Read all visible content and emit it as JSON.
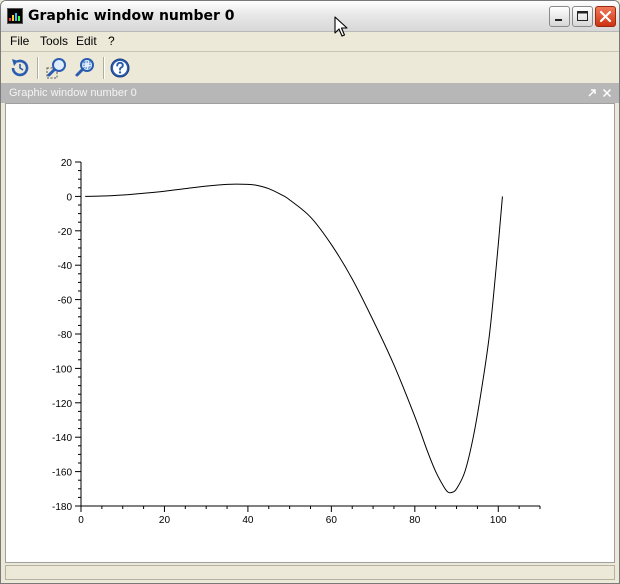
{
  "window": {
    "title": "Graphic window number 0",
    "icon": "scilab-graphic-icon"
  },
  "menu": {
    "items": [
      {
        "id": "file",
        "label": "File"
      },
      {
        "id": "tools",
        "label": "Tools"
      },
      {
        "id": "edit",
        "label": "Edit"
      },
      {
        "id": "help",
        "label": "?"
      }
    ]
  },
  "toolbar": {
    "buttons": [
      {
        "id": "rotate",
        "icon": "rotate-3d-icon"
      },
      {
        "id": "zoom",
        "icon": "zoom-icon"
      },
      {
        "id": "unzoom",
        "icon": "zoom-fit-icon"
      },
      {
        "id": "help",
        "icon": "help-icon"
      }
    ]
  },
  "panel": {
    "title": "Graphic window number 0"
  },
  "colors": {
    "panel_header": "#b7b7b7",
    "curve": "#000000",
    "close_button": "#cc3311"
  },
  "chart_data": {
    "type": "line",
    "title": "",
    "xlabel": "",
    "ylabel": "",
    "xlim": [
      0,
      110
    ],
    "ylim": [
      -180,
      20
    ],
    "xticks": [
      0,
      20,
      40,
      60,
      80,
      100
    ],
    "yticks": [
      20,
      0,
      -20,
      -40,
      -60,
      -80,
      -100,
      -120,
      -140,
      -160,
      -180
    ],
    "x_minor_step": 5,
    "y_minor_step": 5,
    "grid": false,
    "series": [
      {
        "x": [
          1,
          5,
          10,
          15,
          20,
          25,
          30,
          35,
          40,
          42,
          45,
          48,
          50,
          55,
          60,
          65,
          70,
          75,
          80,
          83,
          85,
          87,
          88,
          89,
          90,
          92,
          94,
          96,
          98,
          100,
          101
        ],
        "y": [
          0,
          0.2,
          0.8,
          1.8,
          3,
          4.5,
          6,
          7,
          7,
          6.5,
          4.5,
          1,
          -2,
          -12,
          -28,
          -48,
          -72,
          -98,
          -128,
          -148,
          -160,
          -169,
          -172,
          -172,
          -170,
          -160,
          -140,
          -112,
          -78,
          -28,
          0
        ]
      }
    ]
  }
}
